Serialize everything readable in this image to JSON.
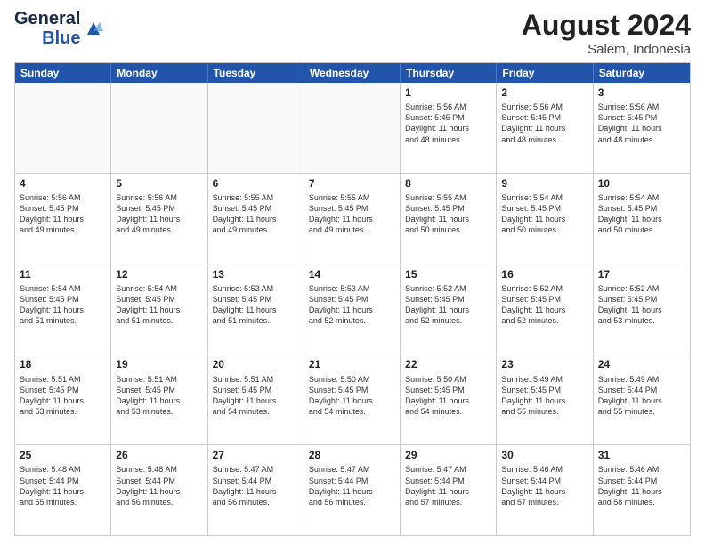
{
  "logo": {
    "line1": "General",
    "line2": "Blue"
  },
  "title": "August 2024",
  "location": "Salem, Indonesia",
  "header_days": [
    "Sunday",
    "Monday",
    "Tuesday",
    "Wednesday",
    "Thursday",
    "Friday",
    "Saturday"
  ],
  "rows": [
    [
      {
        "day": "",
        "info": "",
        "empty": true
      },
      {
        "day": "",
        "info": "",
        "empty": true
      },
      {
        "day": "",
        "info": "",
        "empty": true
      },
      {
        "day": "",
        "info": "",
        "empty": true
      },
      {
        "day": "1",
        "info": "Sunrise: 5:56 AM\nSunset: 5:45 PM\nDaylight: 11 hours\nand 48 minutes.",
        "empty": false
      },
      {
        "day": "2",
        "info": "Sunrise: 5:56 AM\nSunset: 5:45 PM\nDaylight: 11 hours\nand 48 minutes.",
        "empty": false
      },
      {
        "day": "3",
        "info": "Sunrise: 5:56 AM\nSunset: 5:45 PM\nDaylight: 11 hours\nand 48 minutes.",
        "empty": false
      }
    ],
    [
      {
        "day": "4",
        "info": "Sunrise: 5:56 AM\nSunset: 5:45 PM\nDaylight: 11 hours\nand 49 minutes.",
        "empty": false
      },
      {
        "day": "5",
        "info": "Sunrise: 5:56 AM\nSunset: 5:45 PM\nDaylight: 11 hours\nand 49 minutes.",
        "empty": false
      },
      {
        "day": "6",
        "info": "Sunrise: 5:55 AM\nSunset: 5:45 PM\nDaylight: 11 hours\nand 49 minutes.",
        "empty": false
      },
      {
        "day": "7",
        "info": "Sunrise: 5:55 AM\nSunset: 5:45 PM\nDaylight: 11 hours\nand 49 minutes.",
        "empty": false
      },
      {
        "day": "8",
        "info": "Sunrise: 5:55 AM\nSunset: 5:45 PM\nDaylight: 11 hours\nand 50 minutes.",
        "empty": false
      },
      {
        "day": "9",
        "info": "Sunrise: 5:54 AM\nSunset: 5:45 PM\nDaylight: 11 hours\nand 50 minutes.",
        "empty": false
      },
      {
        "day": "10",
        "info": "Sunrise: 5:54 AM\nSunset: 5:45 PM\nDaylight: 11 hours\nand 50 minutes.",
        "empty": false
      }
    ],
    [
      {
        "day": "11",
        "info": "Sunrise: 5:54 AM\nSunset: 5:45 PM\nDaylight: 11 hours\nand 51 minutes.",
        "empty": false
      },
      {
        "day": "12",
        "info": "Sunrise: 5:54 AM\nSunset: 5:45 PM\nDaylight: 11 hours\nand 51 minutes.",
        "empty": false
      },
      {
        "day": "13",
        "info": "Sunrise: 5:53 AM\nSunset: 5:45 PM\nDaylight: 11 hours\nand 51 minutes.",
        "empty": false
      },
      {
        "day": "14",
        "info": "Sunrise: 5:53 AM\nSunset: 5:45 PM\nDaylight: 11 hours\nand 52 minutes.",
        "empty": false
      },
      {
        "day": "15",
        "info": "Sunrise: 5:52 AM\nSunset: 5:45 PM\nDaylight: 11 hours\nand 52 minutes.",
        "empty": false
      },
      {
        "day": "16",
        "info": "Sunrise: 5:52 AM\nSunset: 5:45 PM\nDaylight: 11 hours\nand 52 minutes.",
        "empty": false
      },
      {
        "day": "17",
        "info": "Sunrise: 5:52 AM\nSunset: 5:45 PM\nDaylight: 11 hours\nand 53 minutes.",
        "empty": false
      }
    ],
    [
      {
        "day": "18",
        "info": "Sunrise: 5:51 AM\nSunset: 5:45 PM\nDaylight: 11 hours\nand 53 minutes.",
        "empty": false
      },
      {
        "day": "19",
        "info": "Sunrise: 5:51 AM\nSunset: 5:45 PM\nDaylight: 11 hours\nand 53 minutes.",
        "empty": false
      },
      {
        "day": "20",
        "info": "Sunrise: 5:51 AM\nSunset: 5:45 PM\nDaylight: 11 hours\nand 54 minutes.",
        "empty": false
      },
      {
        "day": "21",
        "info": "Sunrise: 5:50 AM\nSunset: 5:45 PM\nDaylight: 11 hours\nand 54 minutes.",
        "empty": false
      },
      {
        "day": "22",
        "info": "Sunrise: 5:50 AM\nSunset: 5:45 PM\nDaylight: 11 hours\nand 54 minutes.",
        "empty": false
      },
      {
        "day": "23",
        "info": "Sunrise: 5:49 AM\nSunset: 5:45 PM\nDaylight: 11 hours\nand 55 minutes.",
        "empty": false
      },
      {
        "day": "24",
        "info": "Sunrise: 5:49 AM\nSunset: 5:44 PM\nDaylight: 11 hours\nand 55 minutes.",
        "empty": false
      }
    ],
    [
      {
        "day": "25",
        "info": "Sunrise: 5:48 AM\nSunset: 5:44 PM\nDaylight: 11 hours\nand 55 minutes.",
        "empty": false
      },
      {
        "day": "26",
        "info": "Sunrise: 5:48 AM\nSunset: 5:44 PM\nDaylight: 11 hours\nand 56 minutes.",
        "empty": false
      },
      {
        "day": "27",
        "info": "Sunrise: 5:47 AM\nSunset: 5:44 PM\nDaylight: 11 hours\nand 56 minutes.",
        "empty": false
      },
      {
        "day": "28",
        "info": "Sunrise: 5:47 AM\nSunset: 5:44 PM\nDaylight: 11 hours\nand 56 minutes.",
        "empty": false
      },
      {
        "day": "29",
        "info": "Sunrise: 5:47 AM\nSunset: 5:44 PM\nDaylight: 11 hours\nand 57 minutes.",
        "empty": false
      },
      {
        "day": "30",
        "info": "Sunrise: 5:46 AM\nSunset: 5:44 PM\nDaylight: 11 hours\nand 57 minutes.",
        "empty": false
      },
      {
        "day": "31",
        "info": "Sunrise: 5:46 AM\nSunset: 5:44 PM\nDaylight: 11 hours\nand 58 minutes.",
        "empty": false
      }
    ]
  ]
}
